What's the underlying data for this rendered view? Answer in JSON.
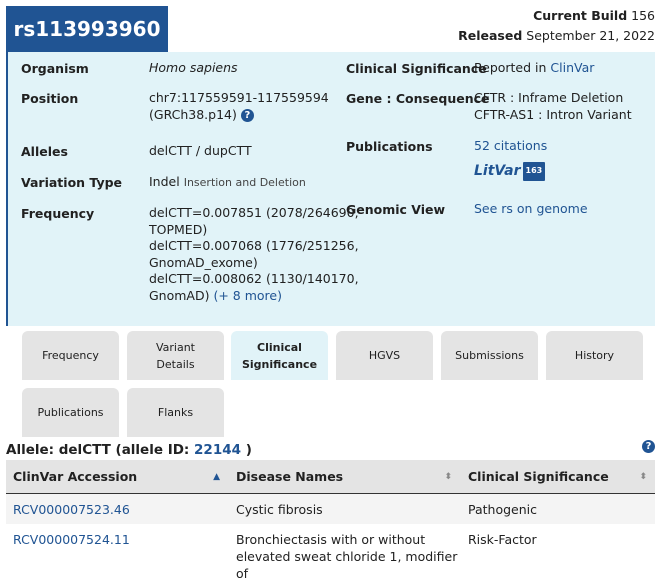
{
  "header": {
    "rsid": "rs113993960",
    "current_build_label": "Current Build",
    "current_build_value": "156",
    "released_label": "Released",
    "released_value": "September 21, 2022"
  },
  "summary": {
    "organism_label": "Organism",
    "organism_value": "Homo sapiens",
    "position_label": "Position",
    "position_line1": "chr7:117559591-117559594",
    "position_line2": "(GRCh38.p14)",
    "alleles_label": "Alleles",
    "alleles_value": "delCTT / dupCTT",
    "variation_type_label": "Variation Type",
    "variation_type_value": "Indel",
    "variation_type_detail": "Insertion and Deletion",
    "frequency_label": "Frequency",
    "frequency_lines": [
      "delCTT=0.007851 (2078/264690,",
      "TOPMED)",
      "delCTT=0.007068 (1776/251256,",
      "GnomAD_exome)",
      "delCTT=0.008062 (1130/140170,",
      "GnomAD)"
    ],
    "frequency_more": "(+ 8 more)",
    "clinical_significance_label": "Clinical Significance",
    "clinical_significance_text": "Reported in",
    "clinical_significance_link": "ClinVar",
    "gene_consequence_label": "Gene : Consequence",
    "gene_consequence_line1": "CFTR : Inframe Deletion",
    "gene_consequence_line2": "CFTR-AS1 : Intron Variant",
    "publications_label": "Publications",
    "publications_link": "52 citations",
    "litvar_text": "LitVar",
    "litvar_count": "163",
    "genomic_view_label": "Genomic View",
    "genomic_view_link": "See rs on genome"
  },
  "tabs": [
    {
      "line1": "Frequency",
      "line2": ""
    },
    {
      "line1": "Variant",
      "line2": "Details"
    },
    {
      "line1": "Clinical",
      "line2": "Significance"
    },
    {
      "line1": "HGVS",
      "line2": ""
    },
    {
      "line1": "Submissions",
      "line2": ""
    },
    {
      "line1": "History",
      "line2": ""
    },
    {
      "line1": "Publications",
      "line2": ""
    },
    {
      "line1": "Flanks",
      "line2": ""
    }
  ],
  "allele": {
    "prefix": "Allele: delCTT (allele ID:",
    "id": "22144",
    "suffix": ")"
  },
  "table": {
    "headers": [
      "ClinVar Accession",
      "Disease Names",
      "Clinical Significance"
    ],
    "rows": [
      {
        "accession": "RCV000007523.46",
        "disease": "Cystic fibrosis",
        "disease2": "",
        "significance": "Pathogenic"
      },
      {
        "accession": "RCV000007524.11",
        "disease": "Bronchiectasis with or without",
        "disease2": "elevated sweat chloride 1, modifier of",
        "significance": "Risk-Factor"
      }
    ]
  },
  "icons": {
    "help": "question-circle-icon",
    "sort": "sort-arrows-icon"
  },
  "colors": {
    "primary": "#205493",
    "panel_bg": "#e1f3f8",
    "tab_bg": "#e4e4e4"
  }
}
